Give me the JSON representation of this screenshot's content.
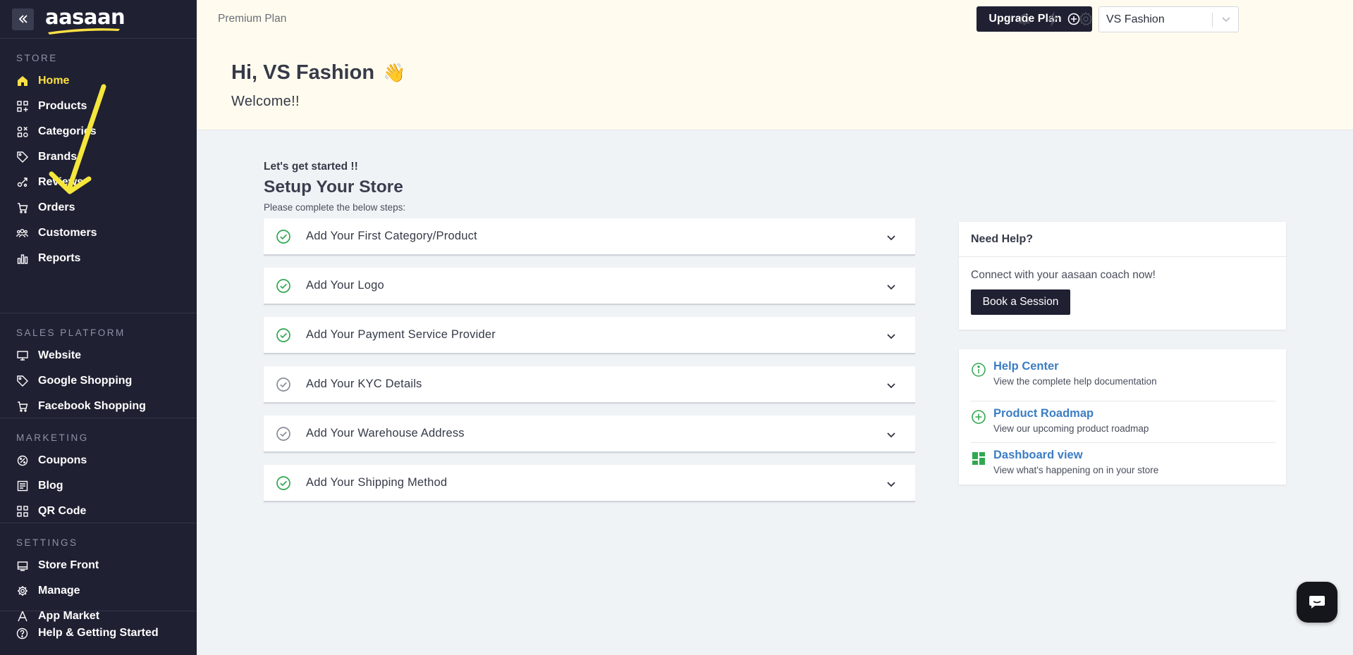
{
  "sidebar": {
    "logo": "aasaan",
    "sections": [
      {
        "title": "STORE",
        "items": [
          {
            "label": "Home",
            "icon": "home-icon",
            "active": true
          },
          {
            "label": "Products",
            "icon": "grid-plus-icon"
          },
          {
            "label": "Categories",
            "icon": "categories-icon"
          },
          {
            "label": "Brands",
            "icon": "tag-icon"
          },
          {
            "label": "Reviews",
            "icon": "reviews-icon"
          },
          {
            "label": "Orders",
            "icon": "cart-icon"
          },
          {
            "label": "Customers",
            "icon": "users-icon"
          },
          {
            "label": "Reports",
            "icon": "bar-chart-icon"
          }
        ]
      },
      {
        "title": "SALES PLATFORM",
        "items": [
          {
            "label": "Website",
            "icon": "monitor-icon"
          },
          {
            "label": "Google Shopping",
            "icon": "tag-icon"
          },
          {
            "label": "Facebook Shopping",
            "icon": "cart-icon"
          }
        ]
      },
      {
        "title": "MARKETING",
        "items": [
          {
            "label": "Coupons",
            "icon": "coupon-icon"
          },
          {
            "label": "Blog",
            "icon": "blog-icon"
          },
          {
            "label": "QR Code",
            "icon": "qr-icon"
          }
        ]
      },
      {
        "title": "SETTINGS",
        "items": [
          {
            "label": "Store Front",
            "icon": "storefront-icon"
          },
          {
            "label": "Manage",
            "icon": "gear-icon"
          },
          {
            "label": "App Market",
            "icon": "app-market-icon"
          }
        ]
      }
    ],
    "bottom_label": "Help & Getting Started"
  },
  "header": {
    "plan": "Premium Plan",
    "upgrade_label": "Upgrade Plan",
    "store_name": "VS Fashion"
  },
  "hero": {
    "greeting": "Hi, VS Fashion",
    "wave": "👋",
    "welcome": "Welcome!!"
  },
  "setup": {
    "kicker": "Let's get started !!",
    "title": "Setup Your Store",
    "subtitle": "Please complete the below steps:",
    "steps": [
      {
        "label": "Add Your First Category/Product",
        "done": true
      },
      {
        "label": "Add Your Logo",
        "done": true
      },
      {
        "label": "Add Your Payment Service Provider",
        "done": true
      },
      {
        "label": "Add Your KYC Details",
        "done": false
      },
      {
        "label": "Add Your Warehouse Address",
        "done": false
      },
      {
        "label": "Add Your Shipping Method",
        "done": true
      }
    ]
  },
  "help": {
    "title": "Need Help?",
    "text": "Connect with your aasaan coach now!",
    "button": "Book a Session",
    "links": [
      {
        "title": "Help Center",
        "desc": "View the complete help documentation",
        "icon": "info-icon"
      },
      {
        "title": "Product Roadmap",
        "desc": "View our upcoming product roadmap",
        "icon": "plus-circle-icon"
      },
      {
        "title": "Dashboard view",
        "desc": "View what's happening on in your store",
        "icon": "dashboard-icon"
      }
    ]
  },
  "colors": {
    "sidebar_bg": "#1f2032",
    "active": "#fde045",
    "hero_bg": "#fffcef",
    "check_done": "#2fa84f",
    "check_pending": "#8a8d99",
    "link": "#3b7dc4",
    "annotation_arrow": "#f5e63c"
  }
}
